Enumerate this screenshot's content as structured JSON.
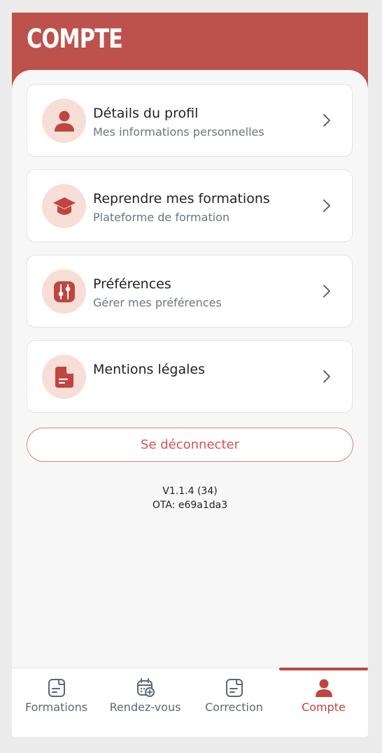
{
  "header": {
    "title": "COMPTE"
  },
  "menu": [
    {
      "title": "Détails du profil",
      "subtitle": "Mes informations personnelles",
      "icon": "user-icon"
    },
    {
      "title": "Reprendre mes formations",
      "subtitle": "Plateforme de formation",
      "icon": "graduation-cap-icon"
    },
    {
      "title": "Préférences",
      "subtitle": "Gérer mes préférences",
      "icon": "sliders-icon"
    },
    {
      "title": "Mentions légales",
      "subtitle": "",
      "icon": "document-icon"
    }
  ],
  "logout_label": "Se déconnecter",
  "version": {
    "app": "V1.1.4 (34)",
    "ota": "OTA: e69a1da3"
  },
  "tabs": [
    {
      "label": "Formations",
      "icon": "notes-icon",
      "active": false
    },
    {
      "label": "Rendez-vous",
      "icon": "calendar-add-icon",
      "active": false
    },
    {
      "label": "Correction",
      "icon": "correction-icon",
      "active": false
    },
    {
      "label": "Compte",
      "icon": "user-icon",
      "active": true
    }
  ],
  "colors": {
    "brand": "#bd514b",
    "icon_circle": "#f7ded7",
    "active_tab": "#c0453e"
  }
}
